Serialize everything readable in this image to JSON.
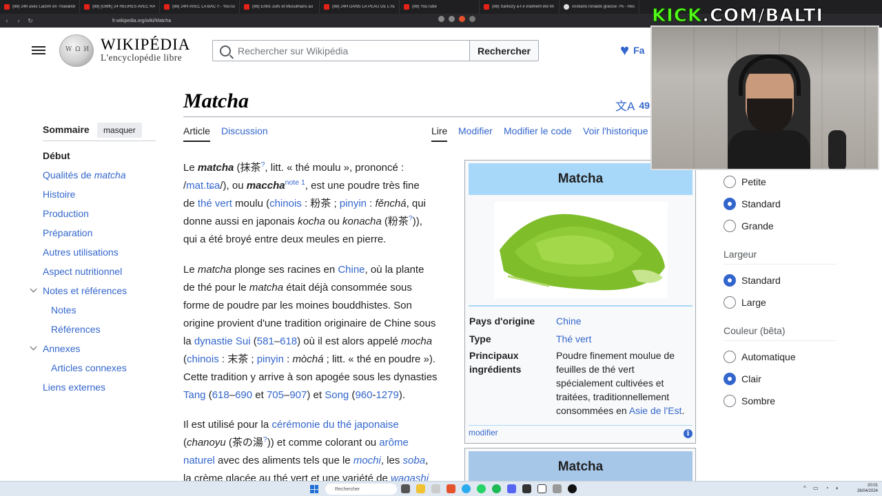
{
  "browser": {
    "tabs": [
      {
        "title": "(88) 24h avec Lacrim en Thaïlande",
        "favicon": "youtube"
      },
      {
        "title": "(88) [GMK] 24 HEURES AVEC RAGE",
        "favicon": "youtube"
      },
      {
        "title": "(88) 24H AVEC LA BAC !! - YouTube",
        "favicon": "youtube"
      },
      {
        "title": "(88) Entre Juifs et Musulmans au T",
        "favicon": "youtube"
      },
      {
        "title": "(88) 24H DANS LA PEAU DE L'ADO",
        "favicon": "youtube"
      },
      {
        "title": "(88) YouTube",
        "favicon": "youtube"
      },
      {
        "title": "(88) Sarkozy a-t-il vraiment été fin",
        "favicon": "youtube"
      },
      {
        "title": "cristiano ronaldo graisse 7% - Rech",
        "favicon": "search"
      }
    ],
    "url": "fr.wikipedia.org/wiki/Matcha"
  },
  "header": {
    "wordmark": "WIKIPÉDIA",
    "tagline": "L'encyclopédie libre",
    "search_placeholder": "Rechercher sur Wikipédia",
    "search_button": "Rechercher",
    "donate": "Fa"
  },
  "article": {
    "title": "Matcha",
    "languages": "49 l",
    "tabs": {
      "article": "Article",
      "discussion": "Discussion",
      "read": "Lire",
      "edit": "Modifier",
      "edit_code": "Modifier le code",
      "history": "Voir l'historique"
    }
  },
  "toc": {
    "heading": "Sommaire",
    "hide": "masquer",
    "items": [
      {
        "label": "Début"
      },
      {
        "label": "Qualités de ",
        "italic": "matcha"
      },
      {
        "label": "Histoire"
      },
      {
        "label": "Production"
      },
      {
        "label": "Préparation"
      },
      {
        "label": "Autres utilisations"
      },
      {
        "label": "Aspect nutritionnel"
      },
      {
        "label": "Notes et références"
      },
      {
        "label": "Notes"
      },
      {
        "label": "Références"
      },
      {
        "label": "Annexes"
      },
      {
        "label": "Articles connexes"
      },
      {
        "label": "Liens externes"
      }
    ]
  },
  "paragraphs": {
    "p1": {
      "l1a": "Le ",
      "l1b": "matcha",
      "l1c": " (抹茶",
      "l1d": "?",
      "l1e": ", litt. « thé moulu », prononcé :",
      "l2a": "/",
      "l2b": "mat.tɕa",
      "l2c": "/), ou ",
      "l2d": "maccha",
      "l2e": "note 1",
      "l2f": ", est une poudre très fine",
      "l3a": "de ",
      "l3b": "thé vert",
      "l3c": " moulu (",
      "l3d": "chinois",
      "l3e": " : 粉茶 ; ",
      "l3f": "pinyin",
      "l3g": " : ",
      "l3h": "fěnchá",
      "l3i": ", qui",
      "l4a": "donne aussi en japonais ",
      "l4b": "kocha",
      "l4c": " ou ",
      "l4d": "konacha",
      "l4e": " (粉茶",
      "l4f": "?",
      "l4g": ")),",
      "l5": "qui a été broyé entre deux meules en pierre."
    },
    "p2": {
      "l1a": "Le ",
      "l1b": "matcha",
      "l1c": " plonge ses racines en ",
      "l1d": "Chine",
      "l1e": ", où la plante",
      "l2a": "de thé pour le ",
      "l2b": "matcha",
      "l2c": " était déjà consommée sous",
      "l3": "forme de poudre par les moines bouddhistes. Son",
      "l4": "origine provient d'une tradition originaire de Chine sous",
      "l5a": "la ",
      "l5b": "dynastie Sui",
      "l5c": " (",
      "l5d": "581",
      "l5e": "–",
      "l5f": "618",
      "l5g": ") où il est alors appelé ",
      "l5h": "mocha",
      "l6a": "(",
      "l6b": "chinois",
      "l6c": " : 末茶 ; ",
      "l6d": "pinyin",
      "l6e": " : ",
      "l6f": "mòchá",
      "l6g": " ; litt. « thé en poudre »).",
      "l7": "Cette tradition y arrive à son apogée sous les dynasties",
      "l8a": "Tang",
      "l8b": " (",
      "l8c": "618",
      "l8d": "–",
      "l8e": "690",
      "l8f": " et ",
      "l8g": "705",
      "l8h": "–",
      "l8i": "907",
      "l8j": ") et ",
      "l8k": "Song",
      "l8l": " (",
      "l8m": "960",
      "l8n": "-",
      "l8o": "1279",
      "l8p": ")."
    },
    "p3": {
      "l1a": "Il est utilisé pour la ",
      "l1b": "cérémonie du thé japonaise",
      "l2a": "(",
      "l2b": "chanoyu",
      "l2c": " (茶の湯",
      "l2d": "?",
      "l2e": ")) et comme colorant ou ",
      "l2f": "arôme",
      "l3a": "naturel",
      "l3b": " avec des aliments tels que le ",
      "l3c": "mochi",
      "l3d": ", les ",
      "l3e": "soba",
      "l3f": ",",
      "l4a": "la crème glacée au thé vert et une variété de ",
      "l4b": "wagashi"
    }
  },
  "infobox": {
    "title": "Matcha",
    "rows": [
      {
        "label": "Pays d'origine",
        "value": "Chine"
      },
      {
        "label": "Type",
        "value": "Thé vert"
      },
      {
        "label": "Principaux ingrédients",
        "value_a": "Poudre finement moulue de feuilles de thé vert spécialement cultivées et traitées, traditionnellement consommées en ",
        "value_link": "Asie de l'Est",
        "value_b": "."
      }
    ],
    "edit": "modifier",
    "info": "i",
    "title2": "Matcha"
  },
  "appearance": {
    "size_options": [
      {
        "label": "Petite",
        "selected": false
      },
      {
        "label": "Standard",
        "selected": true
      },
      {
        "label": "Grande",
        "selected": false
      }
    ],
    "width_heading": "Largeur",
    "width_options": [
      {
        "label": "Standard",
        "selected": true
      },
      {
        "label": "Large",
        "selected": false
      }
    ],
    "color_heading": "Couleur (bêta)",
    "color_options": [
      {
        "label": "Automatique",
        "selected": false
      },
      {
        "label": "Clair",
        "selected": true
      },
      {
        "label": "Sombre",
        "selected": false
      }
    ]
  },
  "overlay": {
    "brand_a": "KICK",
    "brand_b": ".COM/BALTI"
  },
  "taskbar": {
    "search": "Rechercher",
    "time": "20:01",
    "date": "26/04/2024"
  },
  "colors": {
    "link": "#3366cc",
    "infobox_header": "#a7d7f9",
    "kick_green": "#53fc18"
  }
}
